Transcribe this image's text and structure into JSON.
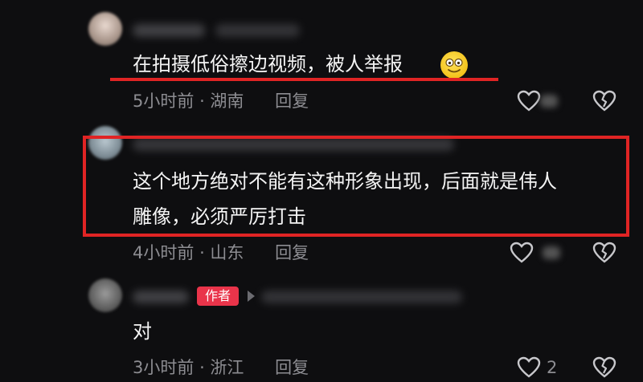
{
  "comments": [
    {
      "text": "在拍摄低俗擦边视频，被人举报",
      "time": "5小时前",
      "location": "湖南",
      "reply_label": "回复"
    },
    {
      "text_line1": "这个地方绝对不能有这种形象出现，后面就是伟人",
      "text_line2": "雕像，必须严厉打击",
      "time": "4小时前",
      "location": "山东",
      "reply_label": "回复"
    },
    {
      "author_badge": "作者",
      "text": "对",
      "time": "3小时前",
      "location": "浙江",
      "reply_label": "回复",
      "like_count": "2"
    }
  ],
  "colors": {
    "background": "#0e0e10",
    "highlight": "#e02424",
    "author_badge": "#e9344a",
    "meta_text": "#8d8d92"
  },
  "icons": [
    "heart-outline-icon",
    "broken-heart-icon",
    "smiling-face-emoji-icon",
    "play-arrow-icon"
  ]
}
